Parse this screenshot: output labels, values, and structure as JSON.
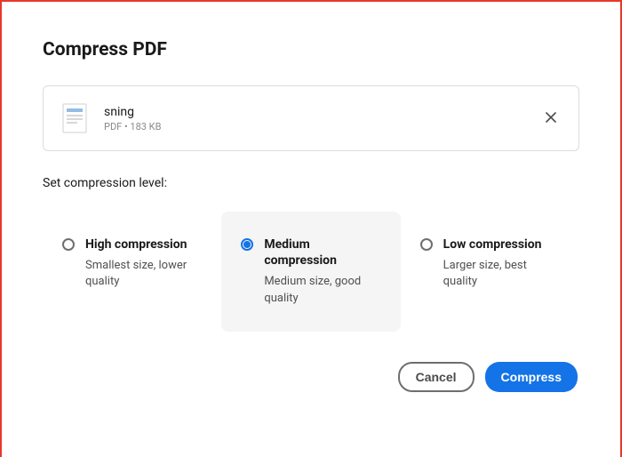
{
  "dialog": {
    "title": "Compress PDF",
    "section_label": "Set compression level:"
  },
  "file": {
    "name": "sning",
    "meta": "PDF • 183 KB"
  },
  "options": [
    {
      "title": "High compression",
      "desc": "Smallest size, lower quality",
      "selected": false
    },
    {
      "title": "Medium compression",
      "desc": "Medium size, good quality",
      "selected": true
    },
    {
      "title": "Low compression",
      "desc": "Larger size, best quality",
      "selected": false
    }
  ],
  "actions": {
    "cancel": "Cancel",
    "compress": "Compress"
  },
  "colors": {
    "accent": "#1473e6",
    "border": "#e8372b"
  }
}
